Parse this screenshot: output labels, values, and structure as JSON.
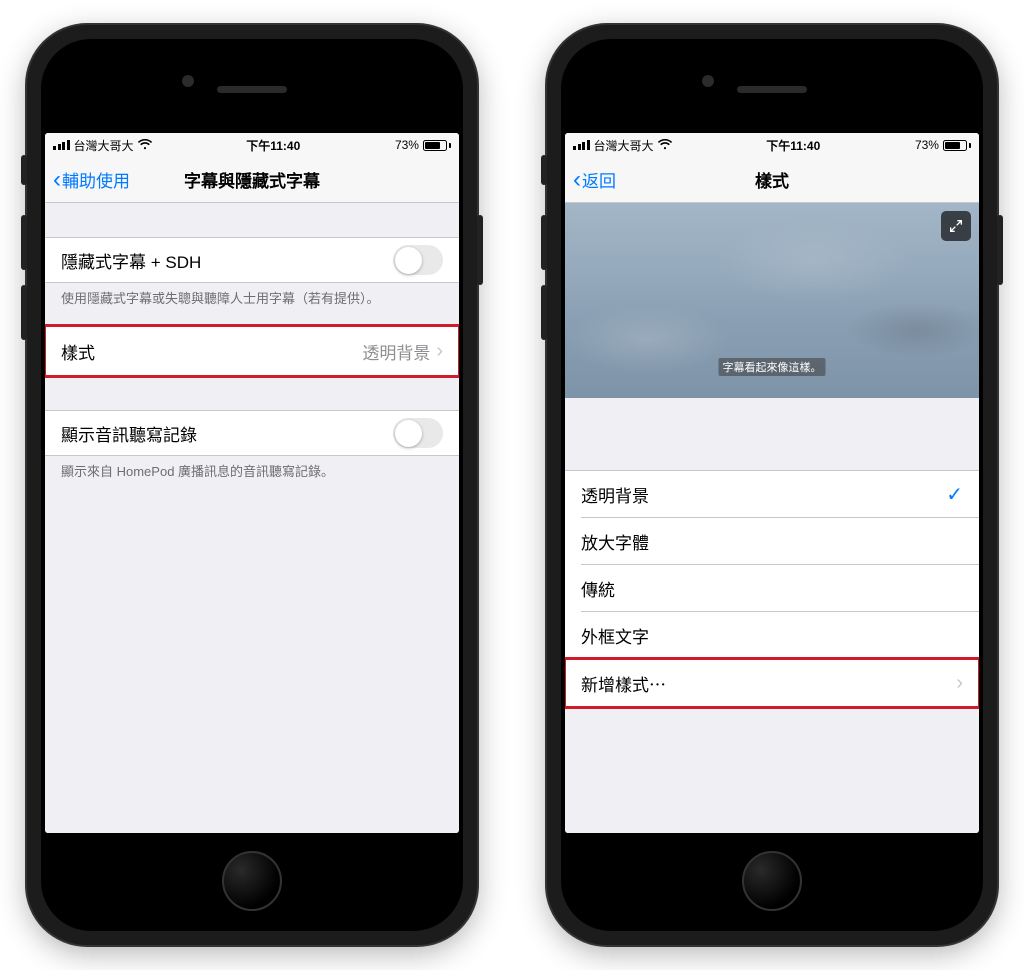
{
  "status": {
    "carrier": "台灣大哥大",
    "time": "下午11:40",
    "battery_pct": "73%"
  },
  "left": {
    "back": "輔助使用",
    "title": "字幕與隱藏式字幕",
    "row_sdh": "隱藏式字幕 + SDH",
    "footer_sdh": "使用隱藏式字幕或失聰與聽障人士用字幕（若有提供）。",
    "row_style": "樣式",
    "row_style_value": "透明背景",
    "row_audio": "顯示音訊聽寫記錄",
    "footer_audio": "顯示來自 HomePod 廣播訊息的音訊聽寫記錄。"
  },
  "right": {
    "back": "返回",
    "title": "樣式",
    "caption": "字幕看起來像這樣。",
    "options": [
      "透明背景",
      "放大字體",
      "傳統",
      "外框文字",
      "新增樣式⋯"
    ]
  }
}
